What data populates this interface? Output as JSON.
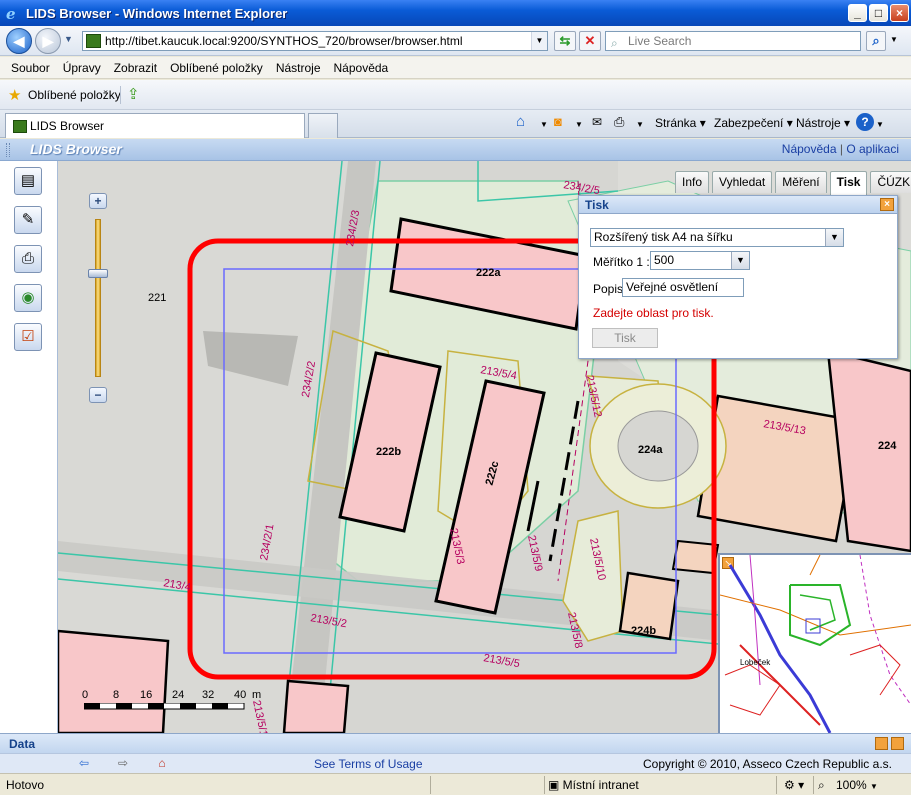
{
  "window": {
    "title": "LIDS Browser - Windows Internet Explorer",
    "minimize": "_",
    "maximize": "□",
    "close": "×"
  },
  "address": {
    "url": "http://tibet.kaucuk.local:9200/SYNTHOS_720/browser/browser.html",
    "search_placeholder": "Live Search"
  },
  "menu": [
    "Soubor",
    "Úpravy",
    "Zobrazit",
    "Oblíbené položky",
    "Nástroje",
    "Nápověda"
  ],
  "favbar": {
    "label": "Oblíbené položky"
  },
  "tabs": {
    "active": "LIDS Browser"
  },
  "commandbar": {
    "page": "Stránka ▾",
    "security": "Zabezpečení ▾",
    "tools": "Nástroje ▾"
  },
  "app": {
    "brand": "LIDS Browser",
    "links": {
      "help": "Nápověda",
      "separator": "|",
      "about": "O aplikaci"
    }
  },
  "panel_tabs": [
    "Info",
    "Vyhledat",
    "Měření",
    "Tisk",
    "ČÚZK"
  ],
  "active_panel_tab": "Tisk",
  "print": {
    "title": "Tisk",
    "layout_value": "Rozšířený tisk A4 na šířku",
    "scale_label": "Měřítko 1 :",
    "scale_value": "500",
    "desc_label": "Popis",
    "desc_value": "Veřejné osvětlení",
    "warning": "Zadejte oblast pro tisk.",
    "button": "Tisk"
  },
  "map": {
    "parcels": [
      "221",
      "222a",
      "222b",
      "222c",
      "224a",
      "224b",
      "224",
      "234/2/5",
      "234/2/3",
      "234/2/2",
      "234/2/1",
      "213/5/4",
      "213/5/12",
      "213/5/13",
      "213/5/3",
      "213/5/9",
      "213/5/10",
      "213/5/8",
      "213/5/2",
      "213/5/5",
      "213/5/1",
      "213/4"
    ],
    "overview_label": "Lobeček"
  },
  "scalebar": {
    "ticks": [
      "0",
      "8",
      "16",
      "24",
      "32",
      "40"
    ],
    "unit": "m"
  },
  "data_panel": {
    "title": "Data"
  },
  "footer": {
    "terms": "See Terms of Usage",
    "copyright": "Copyright © 2010, Asseco Czech Republic a.s."
  },
  "status": {
    "text": "Hotovo",
    "zone": "Místní intranet",
    "zoom": "100%"
  },
  "icons": [
    "ie-icon",
    "back-icon",
    "forward-icon",
    "refresh-icon",
    "stop-icon",
    "search-icon",
    "star-icon",
    "home-icon",
    "rss-icon",
    "mail-icon",
    "print-icon",
    "help-icon"
  ]
}
